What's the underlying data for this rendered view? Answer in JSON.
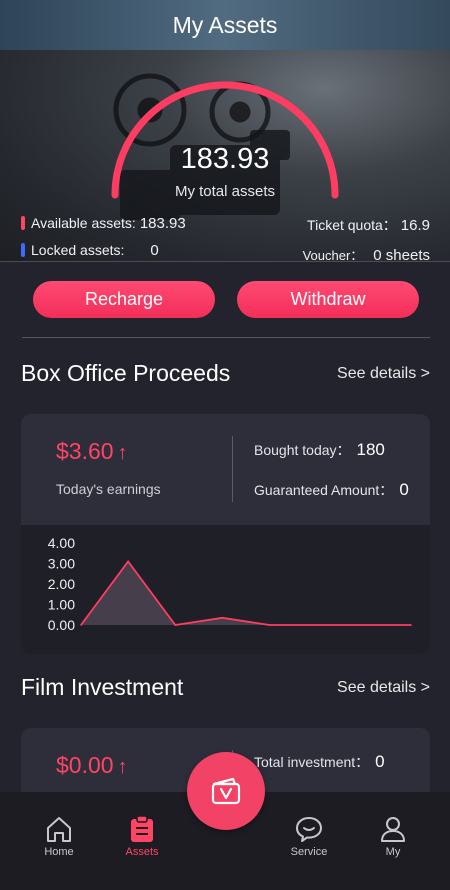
{
  "header": {
    "title": "My Assets"
  },
  "summary": {
    "total_value": "183.93",
    "total_label": "My total assets",
    "available_label": "Available assets:",
    "available_value": "183.93",
    "locked_label": "Locked assets:",
    "locked_value": "0",
    "ticket_label": "Ticket quota：",
    "ticket_value": "16.9",
    "voucher_label": "Voucher：",
    "voucher_value": "0 sheets"
  },
  "actions": {
    "recharge_label": "Recharge",
    "withdraw_label": "Withdraw"
  },
  "box_office": {
    "title": "Box Office Proceeds",
    "see_details": "See details >",
    "earnings_value": "$3.60",
    "earnings_arrow": "↑",
    "earnings_label": "Today's earnings",
    "bought_label": "Bought today：",
    "bought_value": "180",
    "guaranteed_label": "Guaranteed Amount：",
    "guaranteed_value": "0"
  },
  "film_investment": {
    "title": "Film Investment",
    "see_details": "See details >",
    "value": "$0.00",
    "arrow": "↑",
    "total_label": "Total investment：",
    "total_value": "0"
  },
  "chart_data": {
    "type": "area",
    "ylim": [
      0,
      4
    ],
    "y_ticks": [
      "4.00",
      "3.00",
      "2.00",
      "1.00",
      "0.00"
    ],
    "x": [
      0,
      1,
      2,
      3,
      4,
      5,
      6,
      7
    ],
    "values": [
      0,
      3.1,
      0,
      0.35,
      0,
      0,
      0,
      0
    ],
    "line_color": "#ff3d62",
    "fill_color": "#463f4b"
  },
  "nav": {
    "items": [
      {
        "label": "Home",
        "icon": "home-icon"
      },
      {
        "label": "Assets",
        "icon": "assets-icon"
      },
      {
        "label": "Service",
        "icon": "service-icon"
      },
      {
        "label": "My",
        "icon": "user-icon"
      }
    ],
    "fab_icon": "wallet-v-icon"
  },
  "colors": {
    "accent": "#ff4466",
    "button": "#f53462",
    "background": "#23232d",
    "card": "#2e2e3a",
    "available_mark": "#ff4466",
    "locked_mark": "#3b6bff"
  }
}
